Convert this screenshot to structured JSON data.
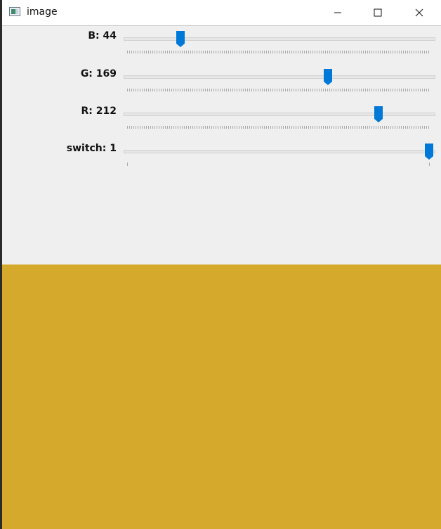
{
  "window": {
    "title": "image",
    "icon": "app-window-icon",
    "buttons": [
      "minimize-icon",
      "maximize-icon",
      "close-icon"
    ]
  },
  "trackbars": [
    {
      "id": "b",
      "label": "B: 44",
      "value": 44,
      "max": 255
    },
    {
      "id": "g",
      "label": "G: 169",
      "value": 169,
      "max": 255
    },
    {
      "id": "r",
      "label": "R: 212",
      "value": 212,
      "max": 255
    },
    {
      "id": "switch",
      "label": "switch: 1",
      "value": 1,
      "max": 1
    }
  ],
  "image": {
    "color": "#d4a92c"
  },
  "colors": {
    "thumb": "#0078d7",
    "panel": "#efefef"
  }
}
